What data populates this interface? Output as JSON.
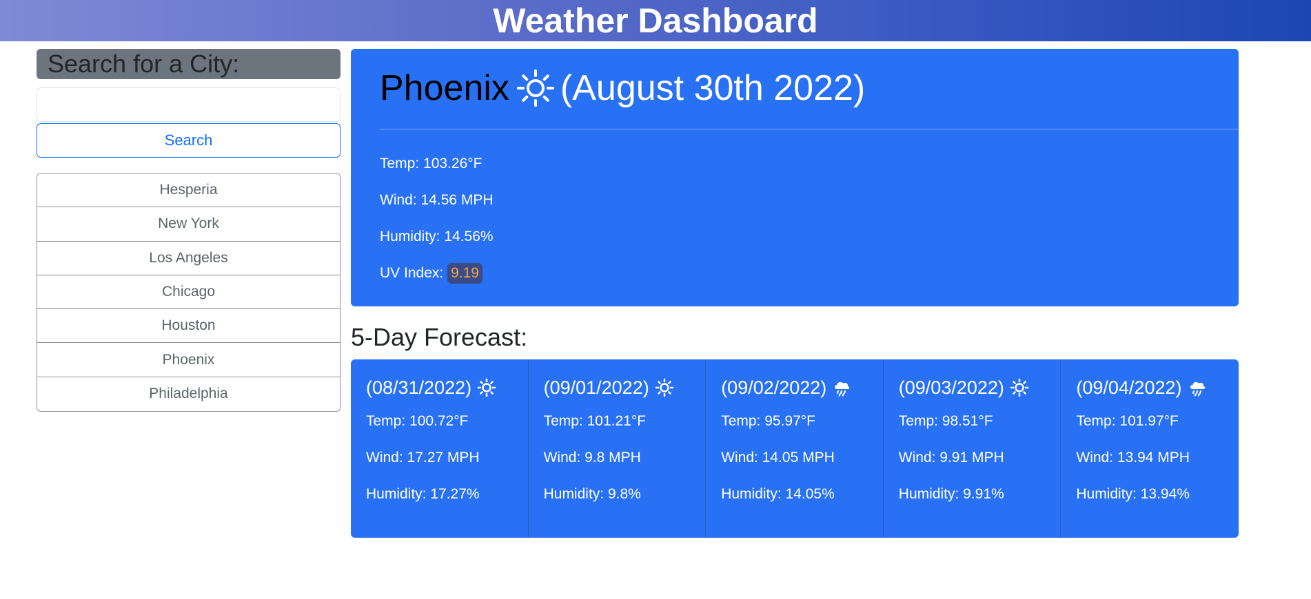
{
  "header": {
    "title": "Weather Dashboard"
  },
  "sidebar": {
    "search_title": "Search for a City:",
    "search_value": "",
    "search_button": "Search",
    "history": [
      "Hesperia",
      "New York",
      "Los Angeles",
      "Chicago",
      "Houston",
      "Phoenix",
      "Philadelphia"
    ]
  },
  "current": {
    "city": "Phoenix",
    "icon": "sun-icon",
    "date": "(August 30th 2022)",
    "temp_label": "Temp: 103.26°F",
    "wind_label": "Wind: 14.56 MPH",
    "humidity_label": "Humidity: 14.56%",
    "uv_label": "UV Index:",
    "uv_value": "9.19"
  },
  "forecast": {
    "title": "5-Day Forecast:",
    "days": [
      {
        "date": "(08/31/2022)",
        "icon": "sun-icon",
        "temp": "Temp: 100.72°F",
        "wind": "Wind: 17.27 MPH",
        "humidity": "Humidity: 17.27%"
      },
      {
        "date": "(09/01/2022)",
        "icon": "sun-icon",
        "temp": "Temp: 101.21°F",
        "wind": "Wind: 9.8 MPH",
        "humidity": "Humidity: 9.8%"
      },
      {
        "date": "(09/02/2022)",
        "icon": "rain-cloud-icon",
        "temp": "Temp: 95.97°F",
        "wind": "Wind: 14.05 MPH",
        "humidity": "Humidity: 14.05%"
      },
      {
        "date": "(09/03/2022)",
        "icon": "sun-icon",
        "temp": "Temp: 98.51°F",
        "wind": "Wind: 9.91 MPH",
        "humidity": "Humidity: 9.91%"
      },
      {
        "date": "(09/04/2022)",
        "icon": "rain-cloud-icon",
        "temp": "Temp: 101.97°F",
        "wind": "Wind: 13.94 MPH",
        "humidity": "Humidity: 13.94%"
      }
    ]
  },
  "colors": {
    "accent": "#2871f4",
    "button": "#0d6efd",
    "uv_badge_bg": "#3b4b86",
    "uv_badge_text": "#f0a64a",
    "search_title_bg": "#6c757d"
  }
}
